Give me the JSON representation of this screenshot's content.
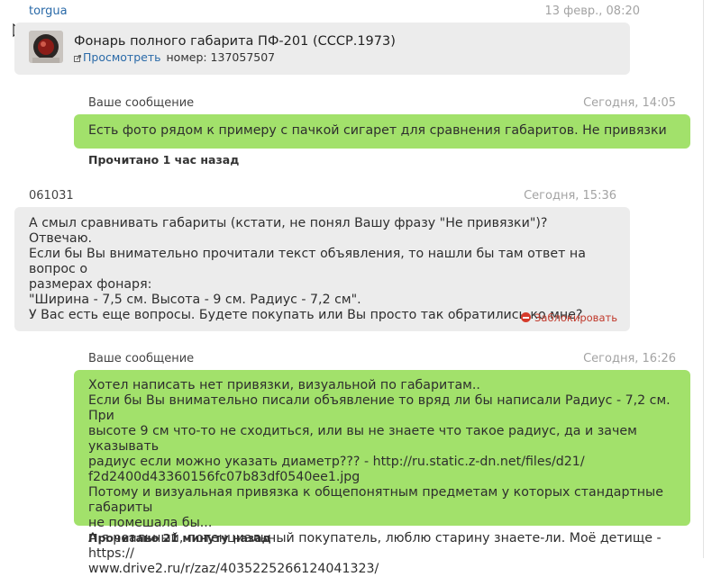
{
  "messages": [
    {
      "author": "torgua",
      "time": "13 февр., 08:20",
      "listing": {
        "title": "Фонарь полного габарита ПФ-201 (СССР.1973)",
        "view_label": "Просмотреть",
        "number_label": "номер: 137057507",
        "thumb_icon": "lantern-thumbnail"
      }
    },
    {
      "author": "Ваше сообщение",
      "time": "Сегодня, 14:05",
      "text": "Есть фото рядом к примеру с пачкой сигарет для сравнения габаритов. Не привязки",
      "read_status": "Прочитано 1 час назад"
    },
    {
      "author": "061031",
      "time": "Сегодня, 15:36",
      "lines": [
        "А смыл сравнивать габариты (кстати, не понял Вашу фразу \"Не привязки\")?",
        "Отвечаю.",
        "Если бы Вы внимательно прочитали текст объявления, то нашли бы там ответ на вопрос о",
        "размерах фонаря:",
        "\"Ширина - 7,5 см. Высота - 9 см. Радиус - 7,2 см\".",
        "У Вас есть еще вопросы. Будете покупать или Вы просто так обратились ко мне?"
      ],
      "block_label": "Заблокировать"
    },
    {
      "author": "Ваше сообщение",
      "time": "Сегодня, 16:26",
      "lines": [
        "Хотел написать нет привязки, визуальной по габаритам..",
        "Если бы Вы внимательно писали объявление то вряд ли бы написали Радиус - 7,2 см. При",
        "высоте 9 см что-то не сходиться, или вы не знаете что такое радиус, да и зачем указывать",
        "радиус если можно указать диаметр??? - http://ru.static.z-dn.net/files/d21/",
        "f2d2400d43360156fc07b83df0540ee1.jpg",
        "Потому и визуальная привязка к общепонятным предметам у которых стандартные габариты",
        "не помешала бы...",
        "А я реальный, потенциальный покупатель, люблю старину знаете-ли. Моё детище -https://",
        "www.drive2.ru/r/zaz/4035225266124041323/"
      ],
      "read_status": "Прочитано 21 минуту назад"
    }
  ],
  "colors": {
    "incoming_bubble": "#ececec",
    "outgoing_bubble": "#a2e16b",
    "link": "#2a6aa8",
    "block": "#d63b2b"
  }
}
